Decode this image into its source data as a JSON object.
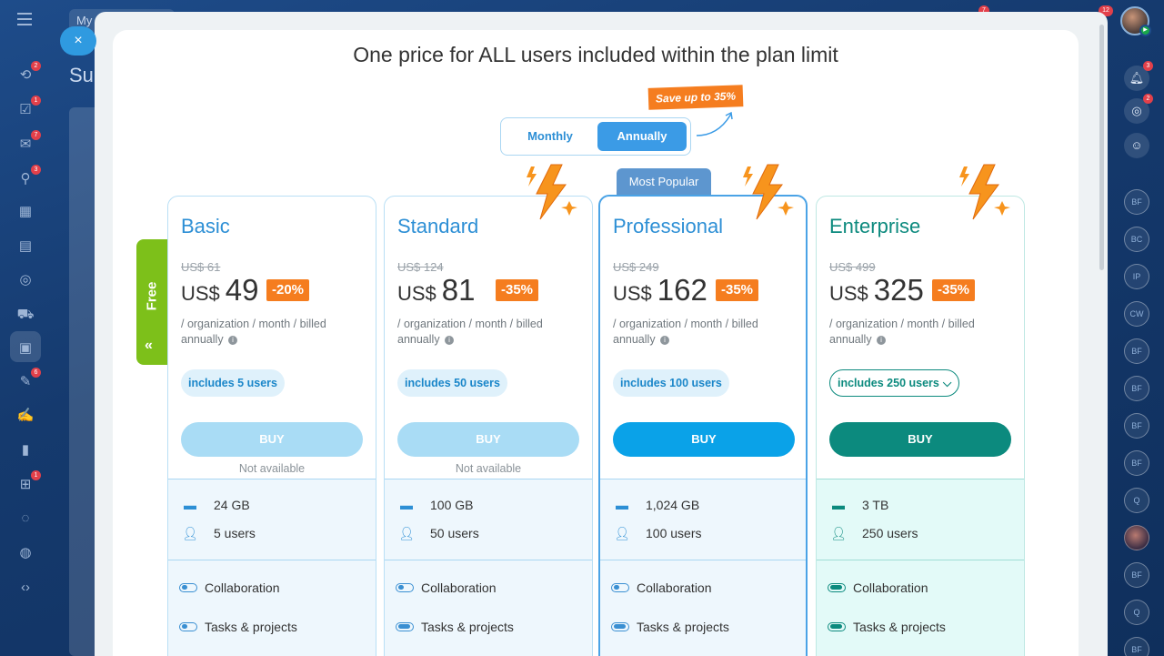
{
  "background": {
    "search_text": "My",
    "title_fragment": "Su",
    "close_icon": "×"
  },
  "left_rail": {
    "items": [
      {
        "icon": "activity-stream-icon",
        "glyph": "⟲",
        "badge": "2"
      },
      {
        "icon": "tasks-icon",
        "glyph": "☑",
        "badge": "1"
      },
      {
        "icon": "chat-icon",
        "glyph": "✉",
        "badge": "7"
      },
      {
        "icon": "crm-icon",
        "glyph": "⚲",
        "badge": "3"
      },
      {
        "icon": "calendar-icon",
        "glyph": "▦",
        "badge": ""
      },
      {
        "icon": "drive-icon",
        "glyph": "▤",
        "badge": ""
      },
      {
        "icon": "goals-icon",
        "glyph": "◎",
        "badge": ""
      },
      {
        "icon": "store-icon",
        "glyph": "⛟",
        "badge": ""
      },
      {
        "icon": "apps-icon",
        "glyph": "▣",
        "badge": ""
      },
      {
        "icon": "forms-icon",
        "glyph": "✎",
        "badge": "6"
      },
      {
        "icon": "sign-icon",
        "glyph": "✍",
        "badge": ""
      },
      {
        "icon": "analytics-icon",
        "glyph": "▮",
        "badge": ""
      },
      {
        "icon": "inbox-icon",
        "glyph": "⊞",
        "badge": "1"
      },
      {
        "icon": "support-icon",
        "glyph": "◌",
        "badge": ""
      },
      {
        "icon": "sites-icon",
        "glyph": "◍",
        "badge": ""
      },
      {
        "icon": "developer-icon",
        "glyph": "‹›",
        "badge": ""
      }
    ]
  },
  "top_badges": {
    "badge_a": "7",
    "badge_b": "12"
  },
  "right_rail": {
    "notifications_badge": "3",
    "second_badge": "2",
    "avatars": [
      "BF",
      "BC",
      "IP",
      "CW",
      "BF",
      "BF",
      "BF",
      "BF",
      "Q",
      "",
      "BF",
      "Q",
      "BF"
    ]
  },
  "pricing": {
    "headline": "One price for ALL users included within the plan limit",
    "billing_toggle": {
      "monthly": "Monthly",
      "annually": "Annually",
      "selected": "Annually"
    },
    "save_tag": "Save up to 35%",
    "free_tab": "Free",
    "most_popular": "Most Popular",
    "plans": [
      {
        "name": "Basic",
        "old_price": "US$ 61",
        "currency": "US$",
        "price": "49",
        "discount": "-20%",
        "period": "/ organization / month / billed annually",
        "users_pill": "includes 5 users",
        "buy": "BUY",
        "availability": "Not available",
        "storage": "24 GB",
        "users": "5 users",
        "features": [
          "Collaboration",
          "Tasks & projects"
        ]
      },
      {
        "name": "Standard",
        "old_price": "US$ 124",
        "currency": "US$",
        "price": "81",
        "discount": "-35%",
        "period": "/ organization / month / billed annually",
        "users_pill": "includes 50 users",
        "buy": "BUY",
        "availability": "Not available",
        "storage": "100 GB",
        "users": "50 users",
        "features": [
          "Collaboration",
          "Tasks & projects"
        ]
      },
      {
        "name": "Professional",
        "old_price": "US$ 249",
        "currency": "US$",
        "price": "162",
        "discount": "-35%",
        "period": "/ organization / month / billed annually",
        "users_pill": "includes 100 users",
        "buy": "BUY",
        "availability": "",
        "storage": "1,024 GB",
        "users": "100 users",
        "features": [
          "Collaboration",
          "Tasks & projects"
        ]
      },
      {
        "name": "Enterprise",
        "old_price": "US$ 499",
        "currency": "US$",
        "price": "325",
        "discount": "-35%",
        "period": "/ organization / month / billed annually",
        "users_pill": "includes 250 users",
        "buy": "BUY",
        "availability": "",
        "storage": "3 TB",
        "users": "250 users",
        "features": [
          "Collaboration",
          "Tasks & projects"
        ]
      }
    ]
  },
  "colors": {
    "accent": "#0aa2e8",
    "discount": "#f57d1f",
    "enterprise": "#0c8a7e",
    "free": "#7dc01a"
  }
}
